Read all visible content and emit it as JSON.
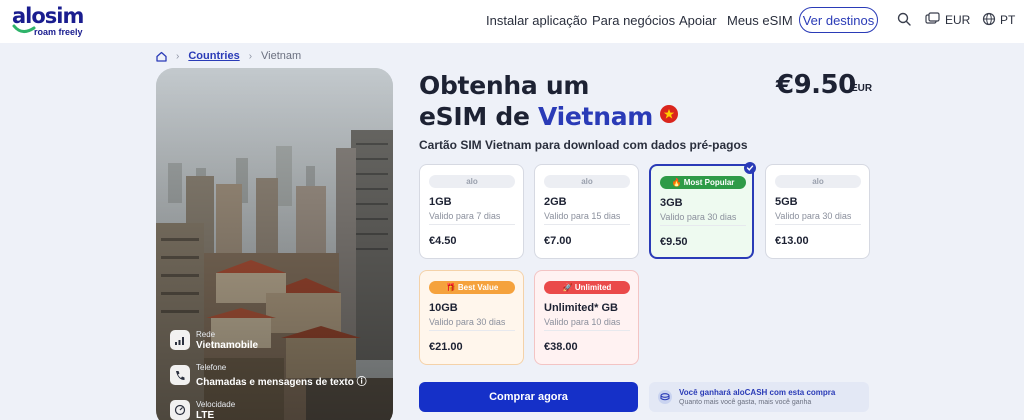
{
  "brand": {
    "name": "alosim",
    "tagline": "roam freely",
    "color": "#1a1d8f"
  },
  "nav": {
    "links": [
      "Instalar aplicação",
      "Para negócios",
      "Apoiar",
      "Meus eSIM"
    ],
    "cta": "Ver destinos",
    "currency": "EUR",
    "language": "PT"
  },
  "breadcrumb": {
    "home_icon": "home-icon",
    "countries": "Countries",
    "current": "Vietnam"
  },
  "hero": {
    "network_label": "Rede",
    "network_value": "Vietnamobile",
    "phone_label": "Telefone",
    "phone_value": "Chamadas e mensagens de texto ⓘ",
    "speed_label": "Velocidade",
    "speed_value": "LTE"
  },
  "product": {
    "title_line1": "Obtenha um",
    "title_prefix": "eSIM de",
    "country": "Vietnam",
    "price": "€9.50",
    "currency": "EUR",
    "subtitle": "Cartão SIM Vietnam para download com dados pré-pagos"
  },
  "plans": [
    {
      "badge": "alo",
      "data": "1GB",
      "validity": "Valido para 7 dias",
      "price": "€4.50"
    },
    {
      "badge": "alo",
      "data": "2GB",
      "validity": "Valido para 15 dias",
      "price": "€7.00"
    },
    {
      "badge": "🔥 Most Popular",
      "data": "3GB",
      "validity": "Valido para 30 dias",
      "price": "€9.50",
      "selected": true
    },
    {
      "badge": "alo",
      "data": "5GB",
      "validity": "Valido para 30 dias",
      "price": "€13.00"
    },
    {
      "badge": "🎁 Best Value",
      "data": "10GB",
      "validity": "Valido para 30 dias",
      "price": "€21.00"
    },
    {
      "badge": "🚀 Unlimited",
      "data": "Unlimited* GB",
      "validity": "Valido para 10 dias",
      "price": "€38.00"
    }
  ],
  "buy": {
    "label": "Comprar agora"
  },
  "cash": {
    "title": "Você ganhará aloCASH com esta compra",
    "subtitle": "Quanto mais você gasta, mais você ganha",
    "icon": "coins-icon"
  },
  "colors": {
    "accent": "#2a3bb7",
    "buy": "#1530c8",
    "popular": "#2e9b47",
    "value": "#f5a23d",
    "unlimited": "#ea4a4a"
  }
}
